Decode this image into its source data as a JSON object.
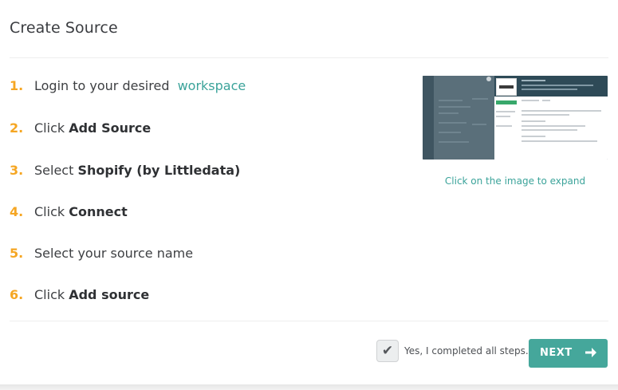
{
  "header": {
    "title": "Create Source"
  },
  "steps": [
    {
      "number": "1.",
      "text": "Login to your desired ",
      "link": "workspace"
    },
    {
      "number": "2.",
      "text": "Click ",
      "bold": "Add Source"
    },
    {
      "number": "3.",
      "text": "Select ",
      "bold": "Shopify (by Littledata)"
    },
    {
      "number": "4.",
      "text": "Click ",
      "bold": "Connect"
    },
    {
      "number": "5.",
      "text": "Select your source name"
    },
    {
      "number": "6.",
      "text": "Click ",
      "bold": "Add source"
    }
  ],
  "preview": {
    "caption": "Click on the image to expand"
  },
  "footer": {
    "checkbox_checked": true,
    "confirm_label": "Yes, I completed all steps.",
    "next_label": "NEXT"
  },
  "colors": {
    "accent": "#45a79b",
    "link": "#3ba39a",
    "step_number": "#f5a623"
  },
  "icons": {
    "checkmark": "check-icon",
    "next_arrow": "arrow-right-icon",
    "preview": "screenshot-thumbnail"
  }
}
